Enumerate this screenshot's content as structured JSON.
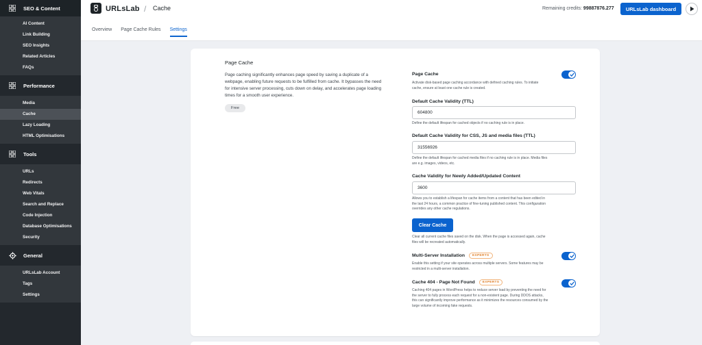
{
  "sidebar": {
    "sections": [
      {
        "label": "SEO & Content",
        "icon": "grid-icon",
        "items": [
          "AI Content",
          "Link Building",
          "SEO Insights",
          "Related Articles",
          "FAQs"
        ]
      },
      {
        "label": "Performance",
        "icon": "grid-icon",
        "items": [
          "Media",
          "Cache",
          "Lazy Loading",
          "HTML Optimisations"
        ]
      },
      {
        "label": "Tools",
        "icon": "grid-icon",
        "items": [
          "URLs",
          "Redirects",
          "Web Vitals",
          "Search and Replace",
          "Code Injection",
          "Database Optimisations",
          "Security"
        ]
      },
      {
        "label": "General",
        "icon": "gear-icon",
        "items": [
          "URLsLab Account",
          "Tags",
          "Settings"
        ]
      }
    ],
    "active_item": "Cache"
  },
  "header": {
    "logo_text": "URLsLab",
    "separator": "/",
    "page_title": "Cache",
    "credits_label": "Remaining credits:",
    "credits_value": "99887876.277",
    "dashboard_button": "URLsLab dashboard"
  },
  "tabs": [
    {
      "label": "Overview",
      "active": false
    },
    {
      "label": "Page Cache Rules",
      "active": false
    },
    {
      "label": "Settings",
      "active": true
    }
  ],
  "card": {
    "title": "Page Cache",
    "description": "Page caching significantly enhances page speed by saving a duplicate of a webpage, enabling future requests to be fulfilled from cache. It bypasses the need for intensive server processing, cuts down on delay, and accelerates page loading times for a smooth user experience.",
    "badge": "Free",
    "page_cache": {
      "label": "Page Cache",
      "enabled": true,
      "help": "Activate disk-based page caching accordance with defined caching rules. To initiate cache, ensure at least one cache rule is created."
    },
    "ttl": {
      "label": "Default Cache Validity (TTL)",
      "value": "604800",
      "help": "Define the default lifespan for cached objects if no caching rule is in place."
    },
    "media_ttl": {
      "label": "Default Cache Validity for CSS, JS and media files (TTL)",
      "value": "31556926",
      "help": "Define the default lifespan for cached media files if no caching rule is in place. Media files are e.g. images, videos, etc."
    },
    "new_content": {
      "label": "Cache Validity for Newly Added/Updated Content",
      "value": "3600",
      "help": "Allows you to establish a lifespan for cache items from a content that has been edited in the last 24 hours, a common practice of fine-tuning published content. This configuration overrides any other cache regulations."
    },
    "clear": {
      "button": "Clear Cache",
      "help": "Clear all current cache files saved on the disk. When the page is accessed again, cache files will be recreated automatically."
    },
    "multi_server": {
      "label": "Multi-Server Installation",
      "badge": "EXPERTS",
      "enabled": true,
      "help": "Enable this setting if your site operates across multiple servers. Some features may be restricted in a multi-server installation."
    },
    "cache_404": {
      "label": "Cache 404 - Page Not Found",
      "badge": "EXPERTS",
      "enabled": true,
      "help": "Caching 404 pages in WordPress helps to reduce server load by preventing the need for the server to fully process each request for a non-existent page. During DDOS attacks, this can significantly improve performance as it minimizes the resources consumed by the large volume of incoming fake requests."
    }
  },
  "colors": {
    "accent": "#0b63ce",
    "sidebar_bg": "#23282d",
    "experts": "#e1812b"
  }
}
